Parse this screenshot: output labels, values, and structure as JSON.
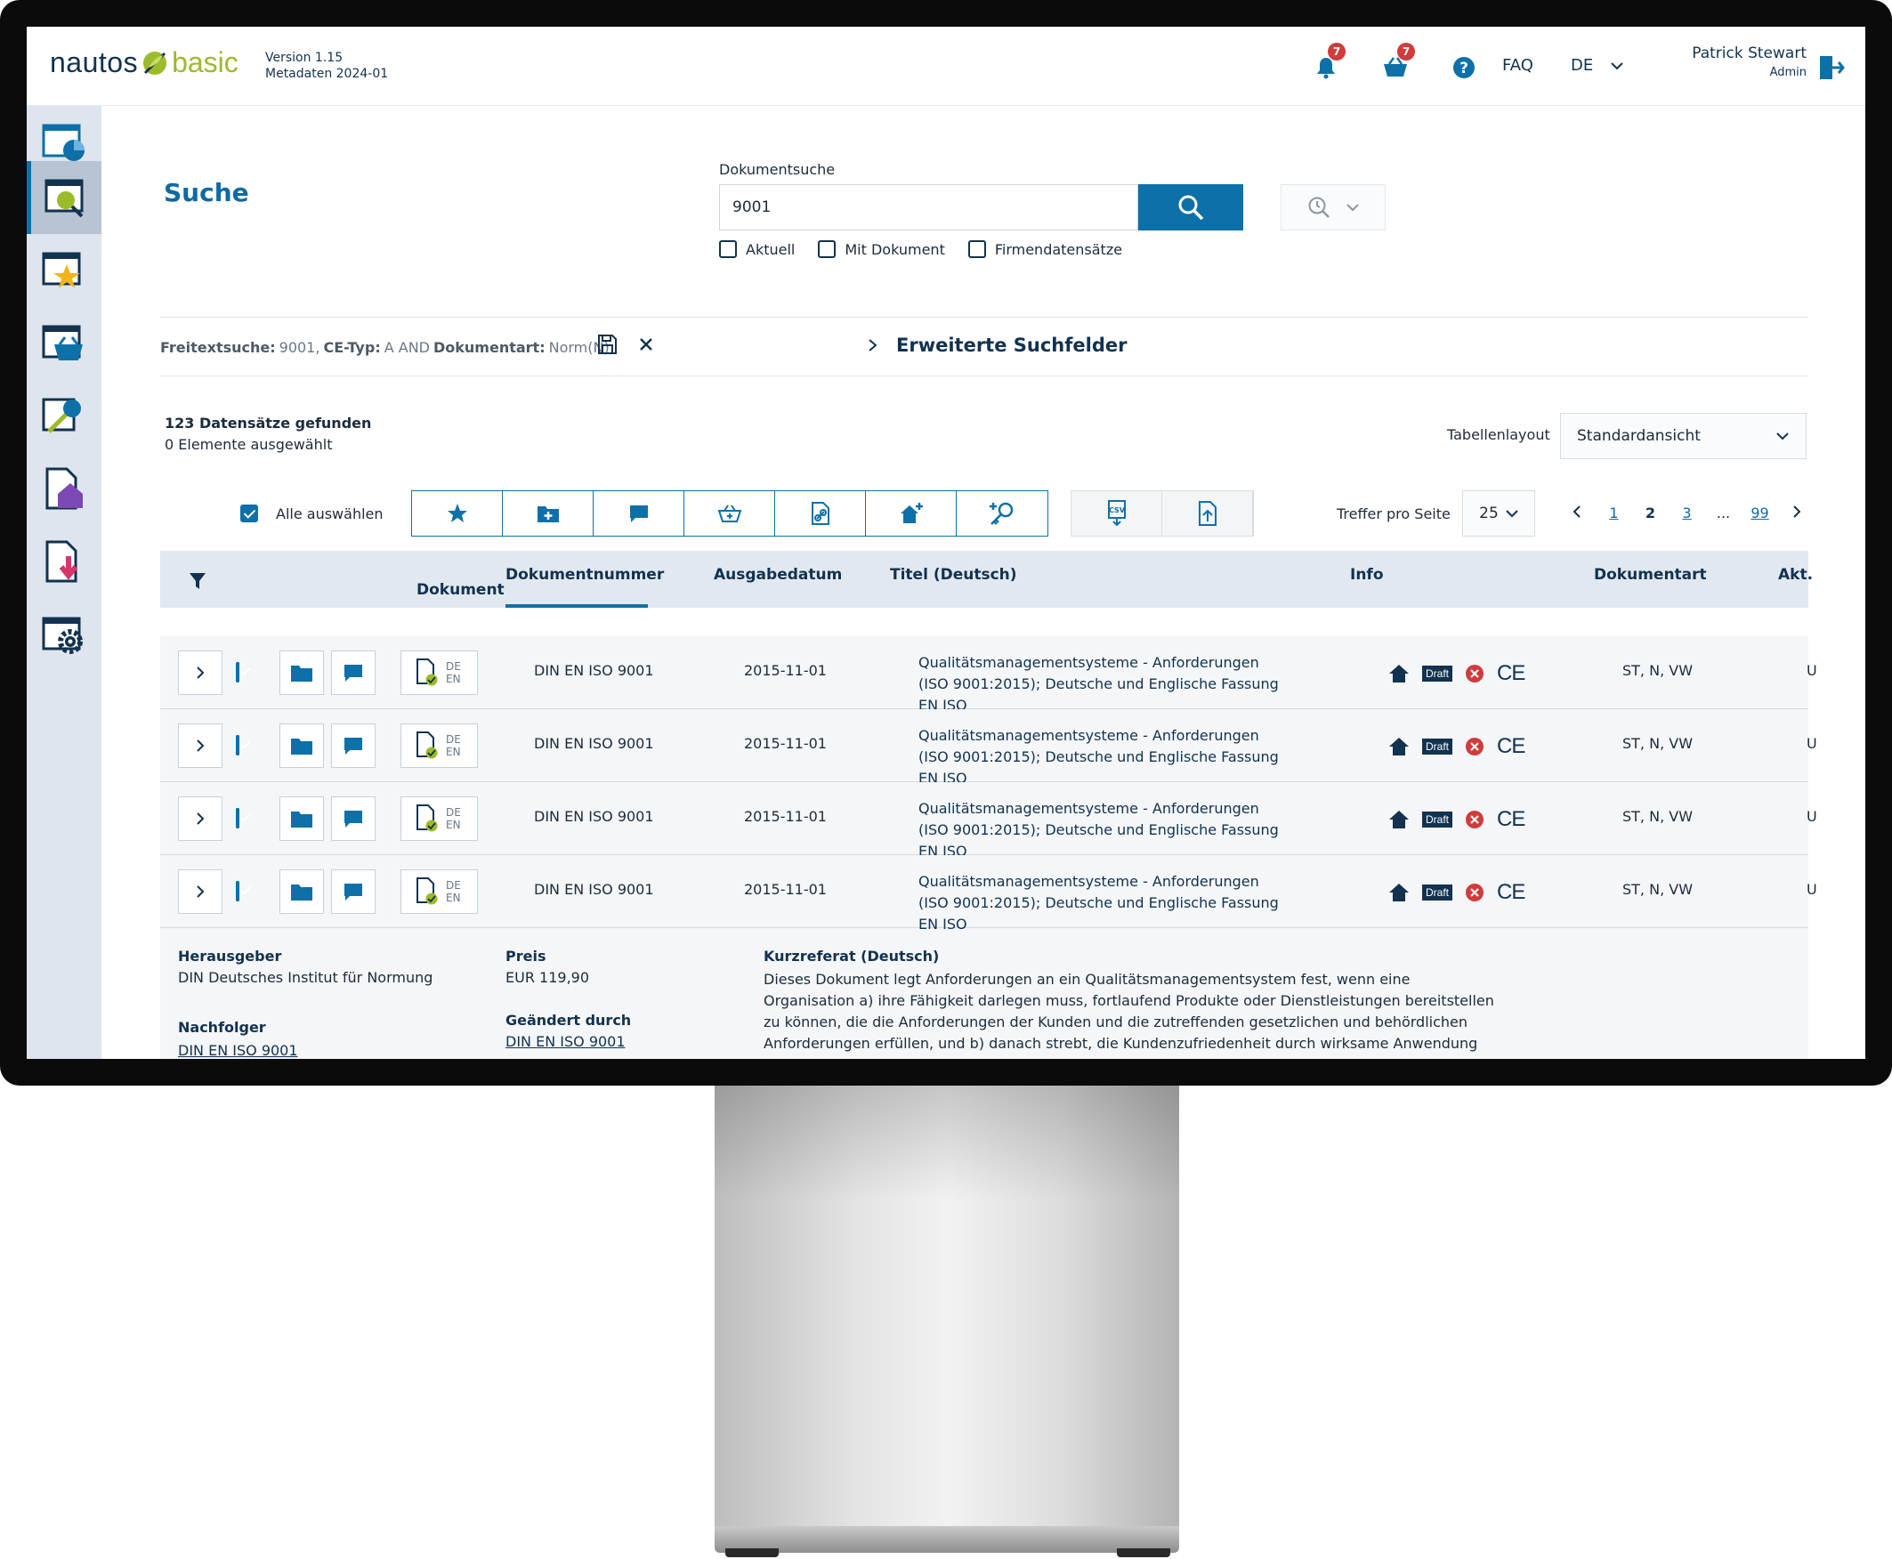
{
  "header": {
    "brand_main": "nautos",
    "brand_sub": "basic",
    "version": "Version 1.15",
    "metadata": "Metadaten 2024-01",
    "notifications_count": "7",
    "cart_count": "7",
    "faq": "FAQ",
    "language": "DE",
    "user_name": "Patrick Stewart",
    "user_role": "Admin"
  },
  "page": {
    "title": "Suche"
  },
  "search": {
    "label": "Dokumentsuche",
    "value": "9001",
    "options": [
      "Aktuell",
      "Mit Dokument",
      "Firmendatensätze"
    ]
  },
  "query": {
    "k1": "Freitextsuche:",
    "v1": "9001,",
    "k2": "CE-Typ:",
    "v2": "A AND",
    "k3": "Dokumentart:",
    "v3": "Norm(N)",
    "extended": "Erweiterte Suchfelder"
  },
  "results": {
    "found": "123 Datensätze gefunden",
    "selected": "0 Elemente ausgewählt",
    "layout_label": "Tabellenlayout",
    "layout_value": "Standardansicht",
    "select_all": "Alle auswählen",
    "per_page_label": "Treffer pro Seite",
    "per_page": "25",
    "pages": {
      "p1": "1",
      "p2": "2",
      "p3": "3",
      "ellipsis": "...",
      "last": "99"
    }
  },
  "table": {
    "columns": {
      "dokument": "Dokument",
      "nummer": "Dokumentnummer",
      "datum": "Ausgabedatum",
      "titel": "Titel (Deutsch)",
      "info": "Info",
      "art": "Dokumentart",
      "akt": "Akt."
    },
    "rows": [
      {
        "nummer": "DIN EN ISO 9001",
        "datum": "2015-11-01",
        "titel": "Qualitätsmanagementsysteme - Anforderungen (ISO 9001:2015); Deutsche und Englische Fassung EN ISO",
        "art": "ST, N, VW",
        "akt": "U",
        "lang1": "DE",
        "lang2": "EN",
        "draft": "Draft",
        "ce": "CE"
      },
      {
        "nummer": "DIN EN ISO 9001",
        "datum": "2015-11-01",
        "titel": "Qualitätsmanagementsysteme - Anforderungen (ISO 9001:2015); Deutsche und Englische Fassung EN ISO",
        "art": "ST, N, VW",
        "akt": "U",
        "lang1": "DE",
        "lang2": "EN",
        "draft": "Draft",
        "ce": "CE"
      },
      {
        "nummer": "DIN EN ISO 9001",
        "datum": "2015-11-01",
        "titel": "Qualitätsmanagementsysteme - Anforderungen (ISO 9001:2015); Deutsche und Englische Fassung EN ISO",
        "art": "ST, N, VW",
        "akt": "U",
        "lang1": "DE",
        "lang2": "EN",
        "draft": "Draft",
        "ce": "CE"
      },
      {
        "nummer": "DIN EN ISO 9001",
        "datum": "2015-11-01",
        "titel": "Qualitätsmanagementsysteme - Anforderungen (ISO 9001:2015); Deutsche und Englische Fassung EN ISO",
        "art": "ST, N, VW",
        "akt": "U",
        "lang1": "DE",
        "lang2": "EN",
        "draft": "Draft",
        "ce": "CE"
      }
    ]
  },
  "details": {
    "herausgeber_label": "Herausgeber",
    "herausgeber": "DIN Deutsches Institut für Normung",
    "nachfolger_label": "Nachfolger",
    "nachfolger": "DIN EN ISO 9001",
    "preis_label": "Preis",
    "preis": "EUR 119,90",
    "geaendert_label": "Geändert durch",
    "geaendert": "DIN EN ISO 9001",
    "kurzreferat_label": "Kurzreferat (Deutsch)",
    "kurzreferat": "Dieses Dokument legt Anforderungen an ein Qualitätsmanagementsystem fest, wenn eine Organisation a) ihre Fähigkeit darlegen muss, fortlaufend Produkte oder Dienstleistungen bereitstellen zu können, die die Anforderungen der Kunden und die zutreffenden gesetzlichen und behördlichen Anforderungen erfüllen, und b) danach strebt, die Kundenzufriedenheit durch wirksame Anwendung des Systems zu erhöhen."
  },
  "colors": {
    "accent": "#0e70a8",
    "navy": "#12324f",
    "brand_green": "#9bbb2a",
    "badge_red": "#d23b3b"
  }
}
